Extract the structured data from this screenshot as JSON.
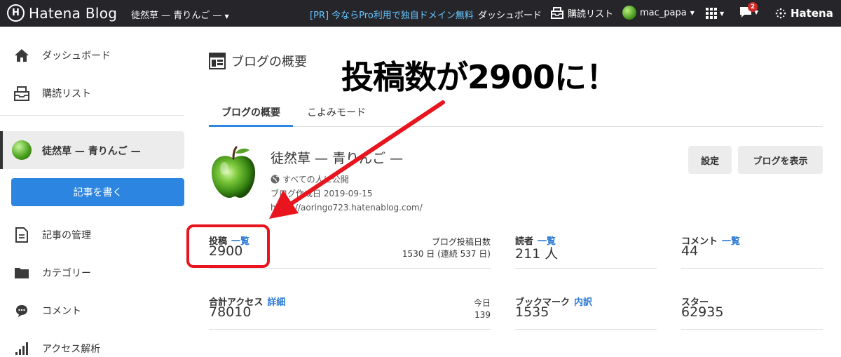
{
  "topbar": {
    "logo_mark": "H",
    "logo_text": "Hatena Blog",
    "blog_selector": "徒然草 — 青りんご —",
    "promo": "[PR] 今ならPro利用で独自ドメイン無料",
    "dashboard": "ダッシュボード",
    "subscriptions": "購読リスト",
    "username": "mac_papa",
    "notification_count": "2",
    "hatena": "Hatena"
  },
  "sidebar": {
    "items": [
      {
        "label": "ダッシュボード",
        "icon": "home-icon"
      },
      {
        "label": "購読リスト",
        "icon": "inbox-icon"
      },
      {
        "label": "徒然草 — 青りんご —",
        "icon": "apple-avatar"
      },
      {
        "label": "記事の管理",
        "icon": "document-icon"
      },
      {
        "label": "カテゴリー",
        "icon": "folder-icon"
      },
      {
        "label": "コメント",
        "icon": "comment-icon"
      },
      {
        "label": "アクセス解析",
        "icon": "bars-icon"
      }
    ],
    "write_button": "記事を書く"
  },
  "main": {
    "page_title": "ブログの概要",
    "tabs": [
      {
        "label": "ブログの概要",
        "active": true
      },
      {
        "label": "こよみモード",
        "active": false
      }
    ],
    "blog": {
      "name": "徒然草 — 青りんご —",
      "visibility": "すべての人に公開",
      "created": "ブログ作成日 2019-09-15",
      "url": "https://aoringo723.hatenablog.com/"
    },
    "buttons": {
      "settings": "設定",
      "view_blog": "ブログを表示"
    },
    "stats": {
      "posts": {
        "label": "投稿",
        "link": "一覧",
        "value": "2900",
        "side_title": "ブログ投稿日数",
        "side_value": "1530 日 (連続 537 日)"
      },
      "readers": {
        "label": "読者",
        "link": "一覧",
        "value": "211 人"
      },
      "comments": {
        "label": "コメント",
        "link": "一覧",
        "value": "44"
      },
      "access": {
        "label": "合計アクセス",
        "link": "詳細",
        "value": "78010",
        "side_title": "今日",
        "side_value": "139"
      },
      "bookmarks": {
        "label": "ブックマーク",
        "link": "内訳",
        "value": "1535"
      },
      "stars": {
        "label": "スター",
        "value": "62935"
      }
    }
  },
  "annotation": {
    "headline": "投稿数が2900に！",
    "color": "#e8141e"
  }
}
